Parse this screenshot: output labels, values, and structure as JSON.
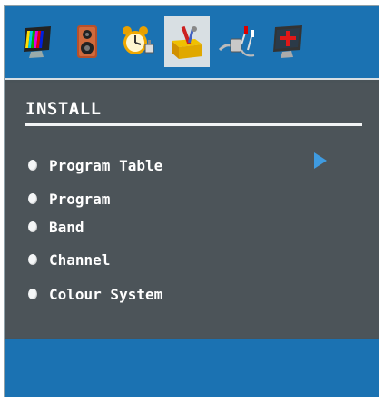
{
  "toolbar": {
    "tabs": [
      {
        "icon": "tv-picture-icon",
        "selected": false
      },
      {
        "icon": "speaker-sound-icon",
        "selected": false
      },
      {
        "icon": "alarm-clock-feature-icon",
        "selected": false
      },
      {
        "icon": "toolbox-install-icon",
        "selected": true
      },
      {
        "icon": "source-cables-icon",
        "selected": false
      },
      {
        "icon": "pc-monitor-icon",
        "selected": false
      }
    ]
  },
  "menu": {
    "title": "INSTALL",
    "items": [
      {
        "label": "Program Table",
        "has_submenu": true
      },
      {
        "label": "Program"
      },
      {
        "label": "Band"
      },
      {
        "label": "Channel"
      },
      {
        "label": "Colour System"
      }
    ]
  },
  "colors": {
    "bar_blue": "#1b72b2",
    "panel_grey": "#4c5459",
    "selected_tab": "#d8dfe3",
    "arrow_blue": "#3f9be0"
  }
}
